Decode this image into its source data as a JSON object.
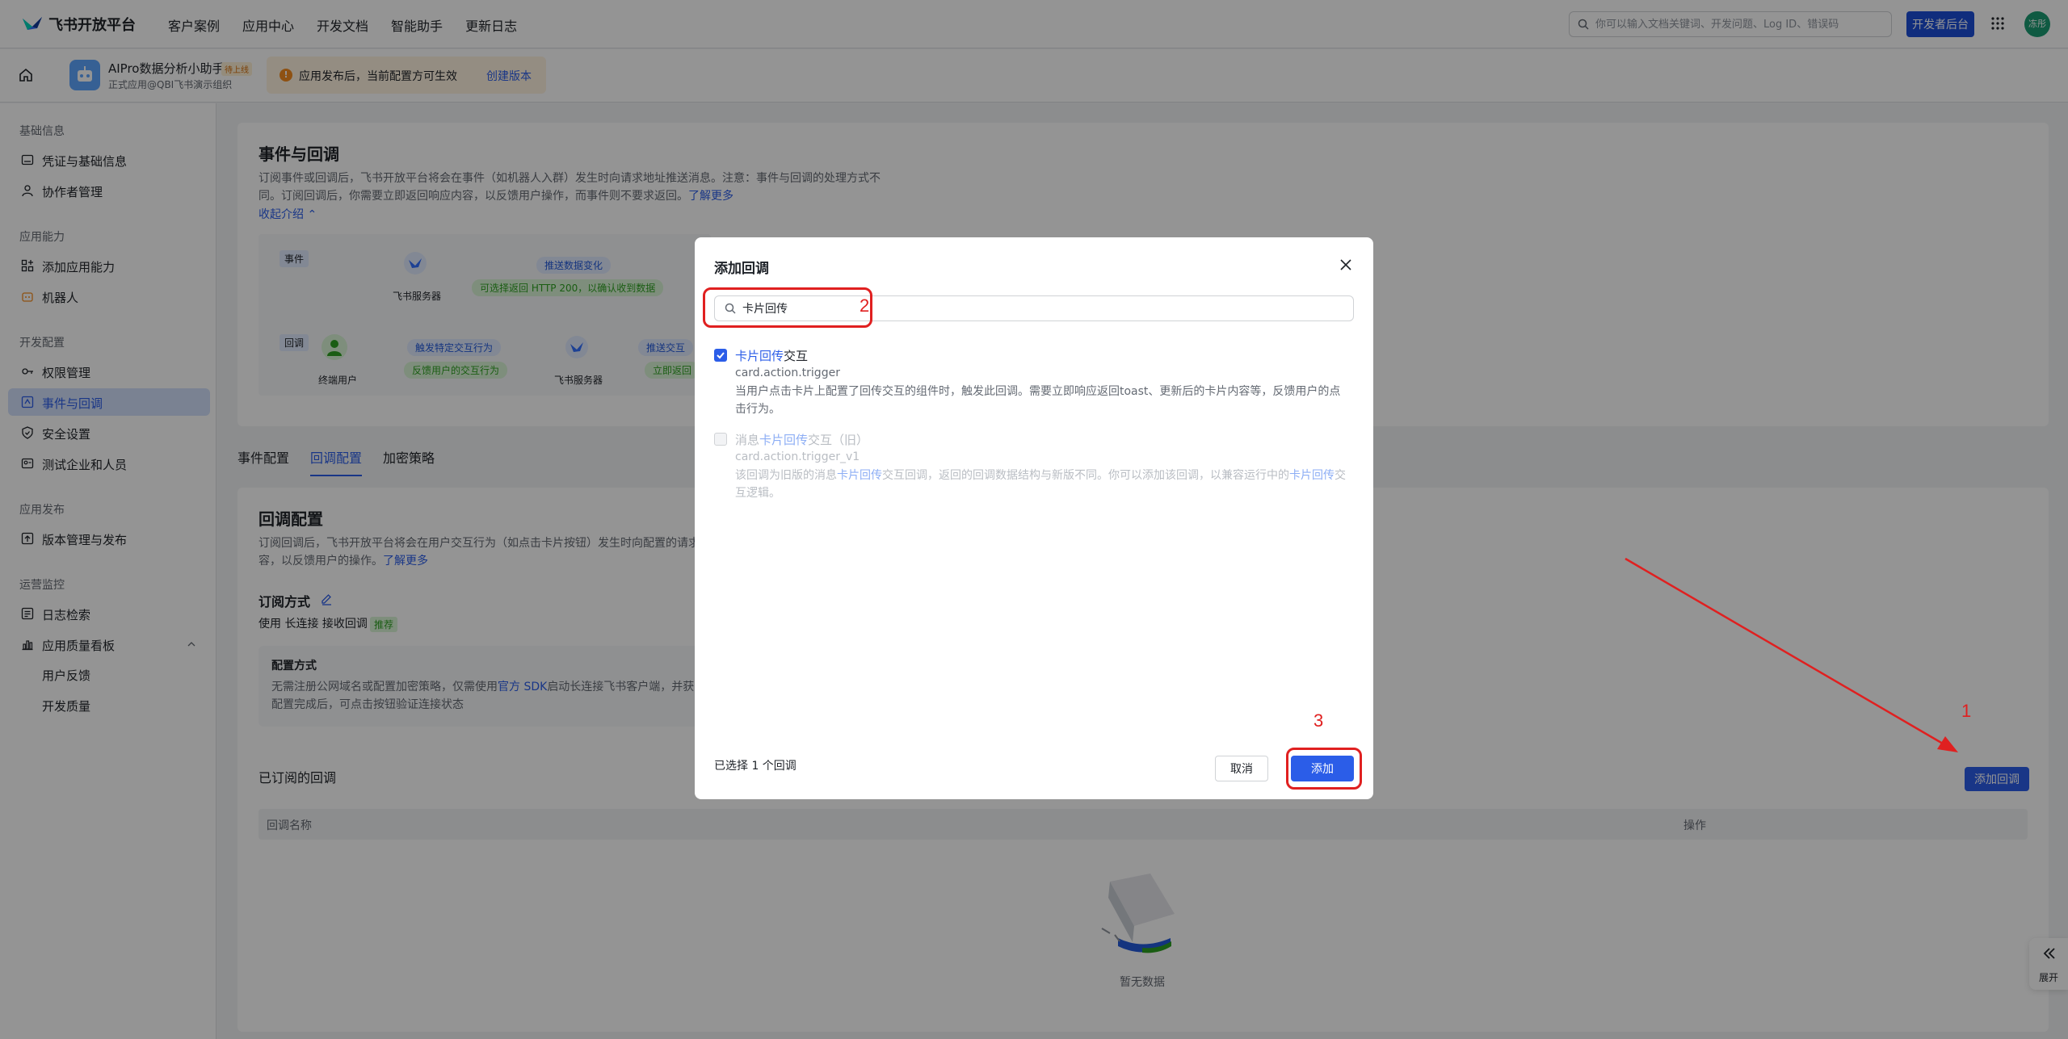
{
  "topbar": {
    "brand": "飞书开放平台",
    "nav": [
      "客户案例",
      "应用中心",
      "开发文档",
      "智能助手",
      "更新日志"
    ],
    "search_placeholder": "你可以输入文档关键词、开发问题、Log ID、错误码",
    "dev_console": "开发者后台",
    "avatar_text": "冻彤"
  },
  "appbar": {
    "app_name": "AIPro数据分析小助手",
    "badge": "待上线",
    "app_sub": "正式应用@QBI飞书演示组织",
    "notice_text": "应用发布后，当前配置方可生效",
    "notice_link": "创建版本"
  },
  "sidebar": {
    "sections": [
      {
        "title": "基础信息",
        "items": [
          "凭证与基础信息",
          "协作者管理"
        ]
      },
      {
        "title": "应用能力",
        "items": [
          "添加应用能力",
          "机器人"
        ]
      },
      {
        "title": "开发配置",
        "items": [
          "权限管理",
          "事件与回调",
          "安全设置",
          "测试企业和人员"
        ]
      },
      {
        "title": "应用发布",
        "items": [
          "版本管理与发布"
        ]
      },
      {
        "title": "运营监控",
        "items": [
          "日志检索",
          "应用质量看板"
        ]
      }
    ],
    "sub_items": [
      "用户反馈",
      "开发质量"
    ],
    "active": "事件与回调"
  },
  "events_card": {
    "title": "事件与回调",
    "desc_line1": "订阅事件或回调后，飞书开放平台将会在事件（如机器人入群）发生时向请求地址推送消息。注意：事件与回调的处理方式不",
    "desc_line2": "同。订阅回调后，你需要立即返回响应内容，以反馈用户操作，而事件则不要求返回。",
    "learn_more": "了解更多",
    "collapse": "收起介绍",
    "diagram": {
      "tag_event": "事件",
      "tag_callback": "回调",
      "server": "飞书服务器",
      "end_user": "终端用户",
      "push_change": "推送数据变化",
      "optional_return": "可选择返回 HTTP 200，以确认收到数据",
      "trigger_interaction": "触发特定交互行为",
      "feedback_user": "反馈用户的交互行为",
      "push_interaction": "推送交互",
      "immediate_return": "立即返回"
    }
  },
  "tabs": [
    "事件配置",
    "回调配置",
    "加密策略"
  ],
  "active_tab": "回调配置",
  "callback_card": {
    "title": "回调配置",
    "desc_line1": "订阅回调后，飞书开放平台将会在用户交互行为（如点击卡片按钮）发生时向配置的请求",
    "desc_line2": "容，以反馈用户的操作。",
    "learn_more": "了解更多",
    "sub_mode_label": "订阅方式",
    "sub_mode_prefix": "使用",
    "sub_mode_value": "长连接",
    "sub_mode_suffix": "接收回调",
    "recommended": "推荐",
    "config_title": "配置方式",
    "config_line1_a": "无需注册公网域名或配置加密策略，仅需使用",
    "config_sdk": "官方 SDK",
    "config_line1_b": "启动长连接飞书客户端，并获",
    "config_line2": "配置完成后，可点击按钮验证连接状态",
    "subscribed_title": "已订阅的回调",
    "add_button": "添加回调",
    "col_name": "回调名称",
    "col_action": "操作",
    "empty": "暂无数据"
  },
  "expand_label": "展开",
  "modal": {
    "title": "添加回调",
    "search_value": "卡片回传",
    "options": [
      {
        "title_hl": "卡片回传",
        "title_rest": "交互",
        "code": "card.action.trigger",
        "desc": "当用户点击卡片上配置了回传交互的组件时，触发此回调。需要立即响应返回toast、更新后的卡片内容等，反馈用户的点击行为。",
        "checked": true,
        "disabled": false
      },
      {
        "title_pre": "消息",
        "title_hl": "卡片回传",
        "title_rest": "交互（旧）",
        "code": "card.action.trigger_v1",
        "desc_a": "该回调为旧版的消息",
        "desc_hl1": "卡片回传",
        "desc_b": "交互回调，返回的回调数据结构与新版不同。你可以添加该回调，以兼容运行中的",
        "desc_hl2": "卡片回传",
        "desc_c": "交互逻辑。",
        "checked": false,
        "disabled": true
      }
    ],
    "selected_count": "已选择 1 个回调",
    "cancel": "取消",
    "add": "添加"
  },
  "annotations": [
    "1",
    "2",
    "3"
  ],
  "colors": {
    "accent": "#2b5de8",
    "annotation": "#e02020",
    "brand_button": "#1d4ed8"
  }
}
